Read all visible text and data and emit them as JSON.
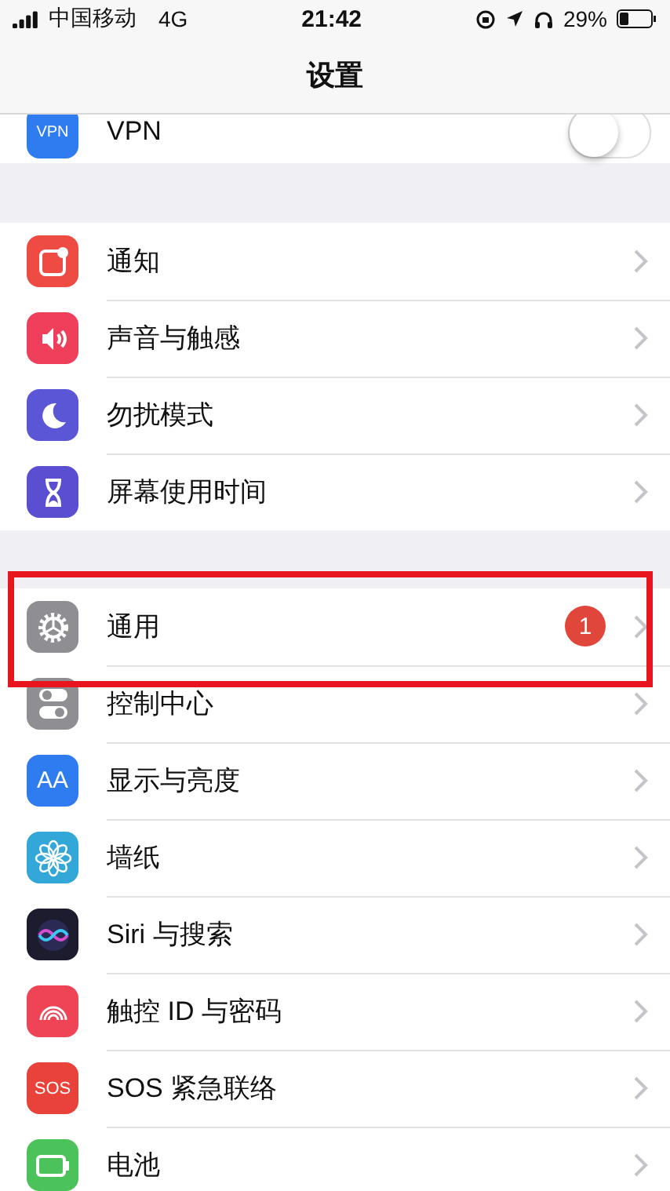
{
  "status_bar": {
    "carrier": "中国移动",
    "network": "4G",
    "time": "21:42",
    "battery": "29%"
  },
  "nav": {
    "title": "设置"
  },
  "vpn": {
    "icon_text": "VPN",
    "label": "VPN",
    "on": false
  },
  "groups": [
    {
      "rows": [
        {
          "label": "通知",
          "color": "#ee4b43",
          "highlighted": false
        },
        {
          "label": "声音与触感",
          "color": "#ef3f5b",
          "highlighted": false
        },
        {
          "label": "勿扰模式",
          "color": "#5b56d6",
          "highlighted": false
        },
        {
          "label": "屏幕使用时间",
          "color": "#5a4fd0",
          "highlighted": false
        }
      ]
    },
    {
      "rows": [
        {
          "label": "通用",
          "color": "#8e8e93",
          "badge": "1",
          "highlighted": true
        },
        {
          "label": "控制中心",
          "color": "#8e8e93",
          "highlighted": false
        },
        {
          "label": "显示与亮度",
          "color": "#2f7cf0",
          "icon_text": "AA",
          "highlighted": false
        },
        {
          "label": "墙纸",
          "color": "#33a7d8",
          "highlighted": false
        },
        {
          "label": "Siri 与搜索",
          "color": "#1c1c2e",
          "highlighted": false
        },
        {
          "label": "触控 ID 与密码",
          "color": "#ee4455",
          "highlighted": false
        },
        {
          "label": "SOS 紧急联络",
          "color": "#e8423a",
          "icon_text": "SOS",
          "highlighted": false
        },
        {
          "label": "电池",
          "color": "#4cc35a",
          "highlighted": false
        }
      ]
    }
  ]
}
